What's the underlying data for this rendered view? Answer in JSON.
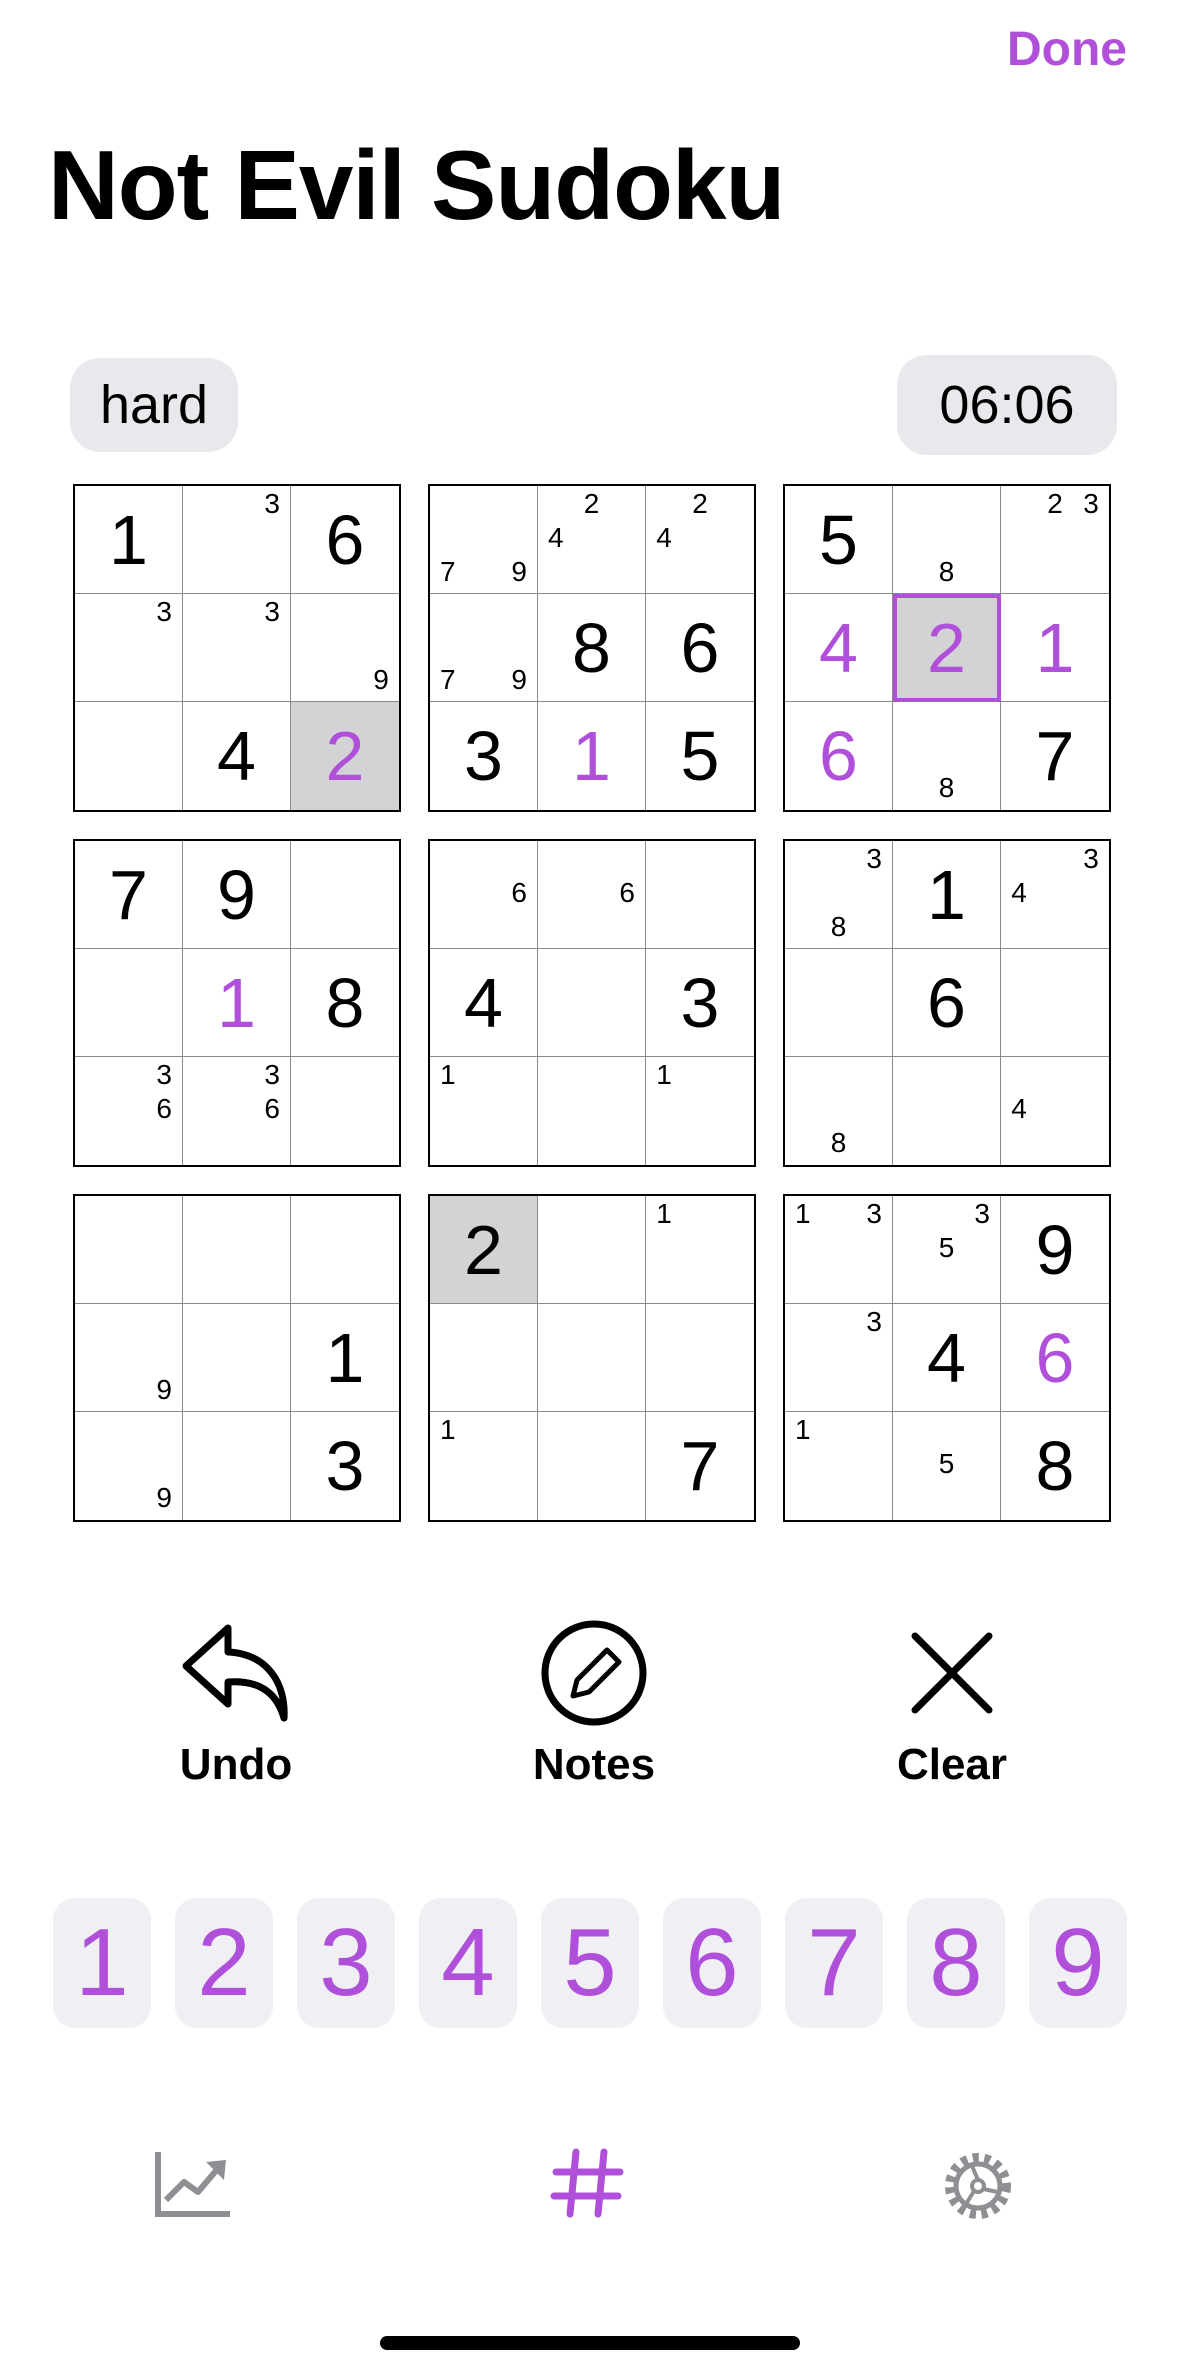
{
  "header": {
    "done_label": "Done",
    "title": "Not Evil Sudoku"
  },
  "status": {
    "difficulty": "hard",
    "timer": "06:06"
  },
  "board": {
    "boxes": [
      {
        "cells": [
          {
            "value": "1",
            "user": false,
            "notes": []
          },
          {
            "value": "",
            "notes": [
              3
            ]
          },
          {
            "value": "6",
            "user": false,
            "notes": []
          },
          {
            "value": "",
            "notes": [
              3
            ]
          },
          {
            "value": "",
            "notes": [
              3
            ]
          },
          {
            "value": "",
            "notes": [
              9
            ]
          },
          {
            "value": "",
            "notes": []
          },
          {
            "value": "4",
            "user": false,
            "notes": []
          },
          {
            "value": "2",
            "user": true,
            "selected": true,
            "notes": []
          }
        ]
      },
      {
        "cells": [
          {
            "value": "",
            "notes": [
              7,
              9
            ]
          },
          {
            "value": "",
            "notes": [
              2,
              4
            ]
          },
          {
            "value": "",
            "notes": [
              2,
              4
            ]
          },
          {
            "value": "",
            "notes": [
              7,
              9
            ]
          },
          {
            "value": "8",
            "user": false,
            "notes": []
          },
          {
            "value": "6",
            "user": false,
            "notes": []
          },
          {
            "value": "3",
            "user": false,
            "notes": []
          },
          {
            "value": "1",
            "user": true,
            "notes": []
          },
          {
            "value": "5",
            "user": false,
            "notes": []
          }
        ]
      },
      {
        "cells": [
          {
            "value": "5",
            "user": false,
            "notes": []
          },
          {
            "value": "",
            "notes": [
              8
            ]
          },
          {
            "value": "",
            "notes": [
              2,
              3
            ]
          },
          {
            "value": "4",
            "user": true,
            "notes": []
          },
          {
            "value": "2",
            "user": true,
            "focus": true,
            "notes": []
          },
          {
            "value": "1",
            "user": true,
            "notes": []
          },
          {
            "value": "6",
            "user": true,
            "notes": []
          },
          {
            "value": "",
            "notes": [
              8
            ]
          },
          {
            "value": "7",
            "user": false,
            "notes": []
          }
        ]
      },
      {
        "cells": [
          {
            "value": "7",
            "user": false,
            "notes": []
          },
          {
            "value": "9",
            "user": false,
            "notes": []
          },
          {
            "value": "",
            "notes": []
          },
          {
            "value": "",
            "notes": []
          },
          {
            "value": "1",
            "user": true,
            "notes": []
          },
          {
            "value": "8",
            "user": false,
            "notes": []
          },
          {
            "value": "",
            "notes": [
              3,
              6
            ]
          },
          {
            "value": "",
            "notes": [
              3,
              6
            ]
          },
          {
            "value": "",
            "notes": []
          }
        ]
      },
      {
        "cells": [
          {
            "value": "",
            "notes": [
              6
            ]
          },
          {
            "value": "",
            "notes": [
              6
            ]
          },
          {
            "value": "",
            "notes": []
          },
          {
            "value": "4",
            "user": false,
            "notes": []
          },
          {
            "value": "",
            "notes": []
          },
          {
            "value": "3",
            "user": false,
            "notes": []
          },
          {
            "value": "",
            "notes": [
              1
            ]
          },
          {
            "value": "",
            "notes": []
          },
          {
            "value": "",
            "notes": [
              1
            ]
          }
        ]
      },
      {
        "cells": [
          {
            "value": "",
            "notes": [
              3,
              8
            ]
          },
          {
            "value": "1",
            "user": false,
            "notes": []
          },
          {
            "value": "",
            "notes": [
              3,
              4
            ]
          },
          {
            "value": "",
            "notes": []
          },
          {
            "value": "6",
            "user": false,
            "notes": []
          },
          {
            "value": "",
            "notes": []
          },
          {
            "value": "",
            "notes": [
              8
            ]
          },
          {
            "value": "",
            "notes": []
          },
          {
            "value": "",
            "notes": [
              4
            ]
          }
        ]
      },
      {
        "cells": [
          {
            "value": "",
            "notes": []
          },
          {
            "value": "",
            "notes": []
          },
          {
            "value": "",
            "notes": []
          },
          {
            "value": "",
            "notes": [
              9
            ]
          },
          {
            "value": "",
            "notes": []
          },
          {
            "value": "1",
            "user": false,
            "notes": []
          },
          {
            "value": "",
            "notes": [
              9
            ]
          },
          {
            "value": "",
            "notes": []
          },
          {
            "value": "3",
            "user": false,
            "notes": []
          }
        ]
      },
      {
        "cells": [
          {
            "value": "2",
            "user": false,
            "selected": true,
            "notes": []
          },
          {
            "value": "",
            "notes": []
          },
          {
            "value": "",
            "notes": [
              1
            ]
          },
          {
            "value": "",
            "notes": []
          },
          {
            "value": "",
            "notes": []
          },
          {
            "value": "",
            "notes": []
          },
          {
            "value": "",
            "notes": [
              1
            ]
          },
          {
            "value": "",
            "notes": []
          },
          {
            "value": "7",
            "user": false,
            "notes": []
          }
        ]
      },
      {
        "cells": [
          {
            "value": "",
            "notes": [
              1,
              3
            ]
          },
          {
            "value": "",
            "notes": [
              3,
              5
            ]
          },
          {
            "value": "9",
            "user": false,
            "notes": []
          },
          {
            "value": "",
            "notes": [
              3
            ]
          },
          {
            "value": "4",
            "user": false,
            "notes": []
          },
          {
            "value": "6",
            "user": true,
            "notes": []
          },
          {
            "value": "",
            "notes": [
              1
            ]
          },
          {
            "value": "",
            "notes": [
              5
            ]
          },
          {
            "value": "8",
            "user": false,
            "notes": []
          }
        ]
      }
    ]
  },
  "actions": {
    "undo": "Undo",
    "notes": "Notes",
    "clear": "Clear"
  },
  "keypad": [
    "1",
    "2",
    "3",
    "4",
    "5",
    "6",
    "7",
    "8",
    "9"
  ],
  "tabbar": {
    "items": [
      "stats-icon",
      "grid-icon",
      "settings-icon"
    ],
    "active": "grid-icon"
  },
  "colors": {
    "accent": "#b04fd9",
    "selected_cell": "#d3d3d6",
    "pill": "#e9e9ed",
    "key_bg": "#efeff4",
    "inactive_icon": "#8e8e93"
  }
}
